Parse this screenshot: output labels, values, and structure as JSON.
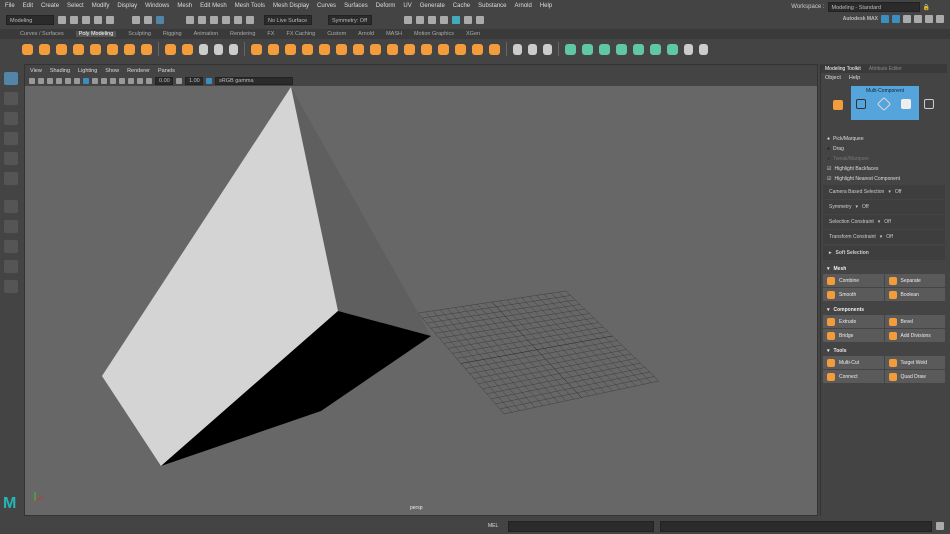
{
  "menubar": [
    "File",
    "Edit",
    "Create",
    "Select",
    "Modify",
    "Display",
    "Windows",
    "Mesh",
    "Edit Mesh",
    "Mesh Tools",
    "Mesh Display",
    "Curves",
    "Surfaces",
    "Deform",
    "UV",
    "Generate",
    "Cache",
    "Substance",
    "Arnold",
    "Help"
  ],
  "status": {
    "mode": "Modeling",
    "live_surface": "No Live Surface",
    "symmetry": "Symmetry: Off"
  },
  "workspace": {
    "label": "Workspace :",
    "value": "Modeling - Standard",
    "brand": "Autodesk MAX"
  },
  "shelf_tabs": [
    "Curves / Surfaces",
    "Poly Modeling",
    "Sculpting",
    "Rigging",
    "Animation",
    "Rendering",
    "FX",
    "FX Caching",
    "Custom",
    "Arnold",
    "MASH",
    "Motion Graphics",
    "XGen"
  ],
  "shelf_active": "Poly Modeling",
  "viewport": {
    "menu": [
      "View",
      "Shading",
      "Lighting",
      "Show",
      "Renderer",
      "Panels"
    ],
    "exposure": "0.00",
    "gamma": "1.00",
    "colorspace": "sRGB gamma",
    "camera": "persp"
  },
  "toolkit": {
    "tabs": [
      "Modeling Toolkit",
      "Attribute Editor"
    ],
    "menu": [
      "Object",
      "Help"
    ],
    "mode": "Multi-Component",
    "selection": [
      "Pick/Marquee",
      "Drag",
      "Tweak/Marquee"
    ],
    "checks": [
      "Highlight Backfaces",
      "Highlight Nearest Component"
    ],
    "props": [
      {
        "label": "Camera Based Selection",
        "value": "Off"
      },
      {
        "label": "Symmetry",
        "value": "Off"
      },
      {
        "label": "Selection Constraint",
        "value": "Off"
      },
      {
        "label": "Transform Constraint",
        "value": "Off"
      }
    ],
    "soft_selection": "Soft Selection",
    "sections": [
      {
        "title": "Mesh",
        "buttons": [
          "Combine",
          "Separate",
          "Smooth",
          "Boolean"
        ]
      },
      {
        "title": "Components",
        "buttons": [
          "Extrude",
          "Bevel",
          "Bridge",
          "Add Divisions"
        ]
      },
      {
        "title": "Tools",
        "buttons": [
          "Multi-Cut",
          "Target Weld",
          "Connect",
          "Quad Draw"
        ]
      }
    ]
  },
  "command_line": {
    "label": "MEL"
  },
  "colors": {
    "accent": "#56a4dc",
    "shelf_orange": "#f39c3c",
    "shelf_green": "#5fc7a2"
  }
}
